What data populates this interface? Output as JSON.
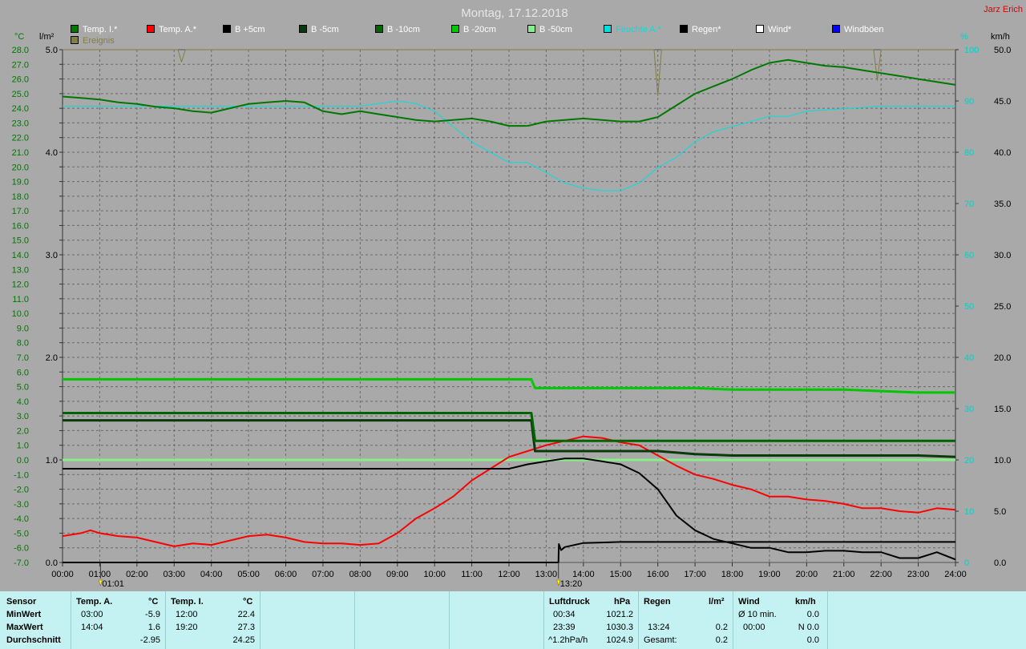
{
  "header": {
    "title": "Montag, 17.12.2018",
    "author": "Jarz Erich"
  },
  "legend": [
    {
      "label": "Temp. I.*",
      "color": "#007800"
    },
    {
      "label": "Temp. A.*",
      "color": "#ff0000"
    },
    {
      "label": "B +5cm",
      "color": "#000000"
    },
    {
      "label": "B -5cm",
      "color": "#0a3a0a"
    },
    {
      "label": "B -10cm",
      "color": "#006400"
    },
    {
      "label": "B -20cm",
      "color": "#00c800"
    },
    {
      "label": "B -50cm",
      "color": "#88ee88"
    },
    {
      "label": "Feuchte A.*",
      "color": "#00e0e0"
    },
    {
      "label": "Regen*",
      "color": "#000000"
    },
    {
      "label": "Wind*",
      "color": "#ffffff"
    },
    {
      "label": "Windböen",
      "color": "#0000ff"
    },
    {
      "label": "Ereignis",
      "color": "#808040"
    }
  ],
  "units": {
    "temp": "°C",
    "rain": "l/m²",
    "humidity": "%",
    "wind": "km/h"
  },
  "chart_data": {
    "type": "line",
    "title": "Montag, 17.12.2018",
    "grid": true,
    "x_tick_labels": [
      "00:00",
      "01:00",
      "02:00",
      "03:00",
      "04:00",
      "05:00",
      "06:00",
      "07:00",
      "08:00",
      "09:00",
      "10:00",
      "11:00",
      "12:00",
      "13:00",
      "14:00",
      "15:00",
      "16:00",
      "17:00",
      "18:00",
      "19:00",
      "20:00",
      "21:00",
      "22:00",
      "23:00",
      "24:00"
    ],
    "xlim": [
      0,
      24
    ],
    "y_temp": {
      "ylim": [
        -7,
        28
      ],
      "tick_step": 1
    },
    "y_rain": {
      "ylim": [
        0,
        5
      ],
      "ticks": [
        "0.0",
        "1.0",
        "2.0",
        "3.0",
        "4.0",
        "5.0"
      ]
    },
    "y_humidity": {
      "ylim": [
        0,
        100
      ],
      "ticks": [
        "0",
        "10",
        "20",
        "30",
        "40",
        "50",
        "60",
        "70",
        "80",
        "90",
        "100"
      ]
    },
    "y_wind": {
      "ylim": [
        0,
        50
      ],
      "ticks": [
        "0.0",
        "5.0",
        "10.0",
        "15.0",
        "20.0",
        "25.0",
        "30.0",
        "35.0",
        "40.0",
        "45.0",
        "50.0"
      ]
    },
    "events": [
      {
        "time": "01:01",
        "x": 1.02
      },
      {
        "time": "13:20",
        "x": 13.33
      }
    ],
    "series": [
      {
        "name": "Temp. I.*",
        "axis": "temp",
        "color": "#007800",
        "width": 2,
        "x": [
          0,
          0.5,
          1,
          1.5,
          2,
          2.5,
          3,
          3.5,
          4,
          4.5,
          5,
          5.5,
          6,
          6.5,
          7,
          7.5,
          8,
          8.5,
          9,
          9.5,
          10,
          10.5,
          11,
          11.5,
          12,
          12.5,
          13,
          13.5,
          14,
          14.5,
          15,
          15.5,
          16,
          16.5,
          17,
          17.5,
          18,
          18.5,
          19,
          19.5,
          20,
          20.5,
          21,
          21.5,
          22,
          22.5,
          23,
          23.5,
          24
        ],
        "y": [
          24.8,
          24.7,
          24.6,
          24.4,
          24.3,
          24.1,
          24.0,
          23.8,
          23.7,
          24.0,
          24.3,
          24.4,
          24.5,
          24.4,
          23.8,
          23.6,
          23.8,
          23.6,
          23.4,
          23.2,
          23.1,
          23.2,
          23.3,
          23.1,
          22.8,
          22.8,
          23.1,
          23.2,
          23.3,
          23.2,
          23.1,
          23.1,
          23.4,
          24.2,
          25.0,
          25.5,
          26.0,
          26.6,
          27.1,
          27.3,
          27.1,
          26.9,
          26.8,
          26.6,
          26.4,
          26.2,
          26.0,
          25.8,
          25.6
        ]
      },
      {
        "name": "Temp. A.*",
        "axis": "temp",
        "color": "#ff0000",
        "width": 2,
        "x": [
          0,
          0.5,
          0.75,
          1,
          1.5,
          2,
          2.5,
          3,
          3.5,
          4,
          4.5,
          5,
          5.5,
          6,
          6.5,
          7,
          7.5,
          8,
          8.5,
          9,
          9.5,
          10,
          10.5,
          11,
          11.5,
          12,
          12.5,
          13,
          13.5,
          14,
          14.5,
          15,
          15.5,
          16,
          16.5,
          17,
          17.5,
          18,
          18.5,
          19,
          19.5,
          20,
          20.5,
          21,
          21.5,
          22,
          22.5,
          23,
          23.5,
          24
        ],
        "y": [
          -5.2,
          -5.0,
          -4.8,
          -5.0,
          -5.2,
          -5.3,
          -5.6,
          -5.9,
          -5.7,
          -5.8,
          -5.5,
          -5.2,
          -5.1,
          -5.3,
          -5.6,
          -5.7,
          -5.7,
          -5.8,
          -5.7,
          -5.0,
          -4.0,
          -3.3,
          -2.5,
          -1.4,
          -0.6,
          0.2,
          0.6,
          1.0,
          1.3,
          1.6,
          1.5,
          1.2,
          1.0,
          0.3,
          -0.4,
          -1.0,
          -1.3,
          -1.7,
          -2.0,
          -2.5,
          -2.5,
          -2.7,
          -2.8,
          -3.0,
          -3.3,
          -3.3,
          -3.5,
          -3.6,
          -3.3,
          -3.4
        ]
      },
      {
        "name": "B +5cm",
        "axis": "temp",
        "color": "#000000",
        "width": 2,
        "x": [
          0,
          12,
          12.5,
          13,
          13.5,
          14,
          14.5,
          15,
          15.5,
          16,
          16.5,
          17,
          17.5,
          18,
          18.5,
          19,
          19.5,
          20,
          20.5,
          21,
          21.5,
          22,
          22.5,
          23,
          23.5,
          24
        ],
        "y": [
          -0.6,
          -0.6,
          -0.3,
          -0.1,
          0.1,
          0.1,
          -0.1,
          -0.3,
          -0.9,
          -2.0,
          -3.8,
          -4.8,
          -5.4,
          -5.7,
          -6.0,
          -6.0,
          -6.3,
          -6.3,
          -6.2,
          -6.2,
          -6.3,
          -6.3,
          -6.7,
          -6.7,
          -6.3,
          -6.8
        ]
      },
      {
        "name": "B -5cm",
        "axis": "temp",
        "color": "#0a3a0a",
        "width": 3,
        "x": [
          0,
          12.6,
          12.7,
          15,
          16,
          17,
          18,
          19,
          20,
          21,
          22,
          23,
          24
        ],
        "y": [
          2.7,
          2.7,
          0.6,
          0.6,
          0.6,
          0.4,
          0.3,
          0.3,
          0.3,
          0.3,
          0.3,
          0.3,
          0.2
        ]
      },
      {
        "name": "B -10cm",
        "axis": "temp",
        "color": "#006400",
        "width": 3,
        "x": [
          0,
          12.6,
          12.7,
          24
        ],
        "y": [
          3.2,
          3.2,
          1.3,
          1.3
        ]
      },
      {
        "name": "B -20cm",
        "axis": "temp",
        "color": "#00c800",
        "width": 3,
        "x": [
          0,
          12.6,
          12.7,
          17,
          18,
          20,
          21,
          22,
          23,
          24
        ],
        "y": [
          5.5,
          5.5,
          4.9,
          4.9,
          4.8,
          4.8,
          4.8,
          4.7,
          4.6,
          4.6
        ]
      },
      {
        "name": "B -50cm",
        "axis": "temp",
        "color": "#88ee88",
        "width": 3,
        "x": [
          0,
          24
        ],
        "y": [
          0.0,
          0.0
        ]
      },
      {
        "name": "Feuchte A.*",
        "axis": "humidity",
        "color": "#00e0e0",
        "width": 1,
        "x": [
          0,
          1,
          2,
          3,
          4,
          5,
          6,
          7,
          8,
          8.5,
          9,
          9.5,
          10,
          10.5,
          11,
          11.5,
          12,
          12.5,
          13,
          13.5,
          14,
          14.5,
          15,
          15.5,
          16,
          16.5,
          17,
          17.5,
          18,
          18.5,
          19,
          19.5,
          20,
          21,
          22,
          23,
          24
        ],
        "y": [
          89,
          89,
          89,
          89,
          89,
          89,
          89,
          89,
          89,
          89.5,
          90,
          89.5,
          88,
          85,
          82,
          80,
          78,
          78,
          76,
          74,
          73,
          72.5,
          72.5,
          74,
          77,
          79,
          82,
          84,
          85,
          86,
          87,
          87,
          88,
          88.5,
          89,
          89,
          89
        ]
      },
      {
        "name": "Regen*",
        "axis": "rain",
        "color": "#000000",
        "width": 2,
        "x": [
          0,
          13.33,
          13.34,
          13.4,
          13.5,
          14,
          15,
          16,
          17,
          18,
          19,
          20,
          21,
          22,
          23,
          24
        ],
        "y": [
          0,
          0,
          0.18,
          0.12,
          0.15,
          0.19,
          0.2,
          0.2,
          0.2,
          0.2,
          0.2,
          0.2,
          0.2,
          0.2,
          0.2,
          0.2
        ]
      },
      {
        "name": "Ereignis",
        "axis": "rain",
        "color": "#808040",
        "width": 1,
        "x": [
          0,
          3.1,
          3.2,
          3.3,
          6,
          8,
          10,
          12,
          15.9,
          16.0,
          16.1,
          20,
          21.8,
          21.9,
          22.0,
          24
        ],
        "y": [
          5,
          5,
          4.88,
          5,
          5,
          5,
          5,
          5,
          5,
          4.55,
          5,
          5,
          5,
          4.7,
          5,
          5
        ]
      }
    ]
  },
  "stats": {
    "sensor": {
      "header": "Sensor",
      "rows": [
        "MinWert",
        "MaxWert",
        "Durchschnitt"
      ]
    },
    "temp_a": {
      "header": "Temp. A.",
      "unit": "°C",
      "min_time": "03:00",
      "min_val": "-5.9",
      "max_time": "14:04",
      "max_val": "1.6",
      "avg": "-2.95"
    },
    "temp_i": {
      "header": "Temp. I.",
      "unit": "°C",
      "min_time": "12:00",
      "min_val": "22.4",
      "max_time": "19:20",
      "max_val": "27.3",
      "avg": "24.25"
    },
    "pressure": {
      "header": "Luftdruck",
      "unit": "hPa",
      "min_time": "00:34",
      "min_val": "1021.2",
      "max_time": "23:39",
      "max_val": "1030.3",
      "trend": "^1.2hPa/h",
      "avg": "1024.9"
    },
    "rain": {
      "header": "Regen",
      "unit": "l/m²",
      "time": "13:24",
      "val": "0.2",
      "total_label": "Gesamt:",
      "total_val": "0.2"
    },
    "wind": {
      "header": "Wind",
      "unit": "km/h",
      "avg_label": "Ø 10 min.",
      "avg_val": "0.0",
      "time": "00:00",
      "dir_val": "N 0.0",
      "last_val": "0.0"
    }
  }
}
